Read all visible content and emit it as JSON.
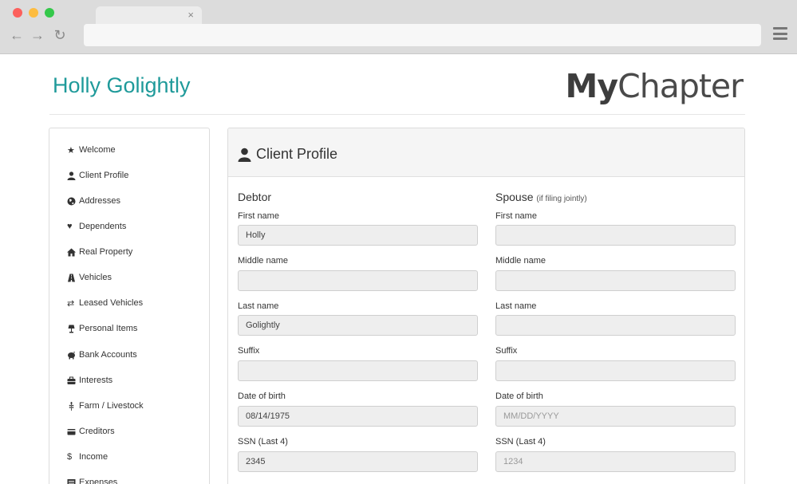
{
  "browser": {
    "tab_close": "×",
    "back": "←",
    "forward": "→",
    "reload": "↻"
  },
  "header": {
    "user_name": "Holly Golightly",
    "logo_bold": "My",
    "logo_rest": "Chapter"
  },
  "sidebar": {
    "items": [
      {
        "label": "Welcome",
        "icon": "★"
      },
      {
        "label": "Client Profile",
        "icon": "person"
      },
      {
        "label": "Addresses",
        "icon": "globe"
      },
      {
        "label": "Dependents",
        "icon": "♥"
      },
      {
        "label": "Real Property",
        "icon": "home"
      },
      {
        "label": "Vehicles",
        "icon": "road"
      },
      {
        "label": "Leased Vehicles",
        "icon": "⇄"
      },
      {
        "label": "Personal Items",
        "icon": "lamp"
      },
      {
        "label": "Bank Accounts",
        "icon": "piggy-bank"
      },
      {
        "label": "Interests",
        "icon": "briefcase"
      },
      {
        "label": "Farm / Livestock",
        "icon": "grain"
      },
      {
        "label": "Creditors",
        "icon": "credit-card"
      },
      {
        "label": "Income",
        "icon": "$"
      },
      {
        "label": "Expenses",
        "icon": "list"
      }
    ]
  },
  "panel": {
    "title": "Client Profile",
    "debtor": {
      "heading": "Debtor",
      "first_name_label": "First name",
      "first_name": "Holly",
      "middle_name_label": "Middle name",
      "middle_name": "",
      "last_name_label": "Last name",
      "last_name": "Golightly",
      "suffix_label": "Suffix",
      "suffix": "",
      "dob_label": "Date of birth",
      "dob": "08/14/1975",
      "ssn_label": "SSN (Last 4)",
      "ssn": "2345"
    },
    "spouse": {
      "heading": "Spouse",
      "heading_note": "(if filing jointly)",
      "first_name_label": "First name",
      "first_name": "",
      "middle_name_label": "Middle name",
      "middle_name": "",
      "last_name_label": "Last name",
      "last_name": "",
      "suffix_label": "Suffix",
      "suffix": "",
      "dob_label": "Date of birth",
      "dob_placeholder": "MM/DD/YYYY",
      "ssn_label": "SSN (Last 4)",
      "ssn_placeholder": "1234"
    }
  },
  "colors": {
    "accent": "#1f9a9a",
    "field_bg": "#eeeeee"
  }
}
